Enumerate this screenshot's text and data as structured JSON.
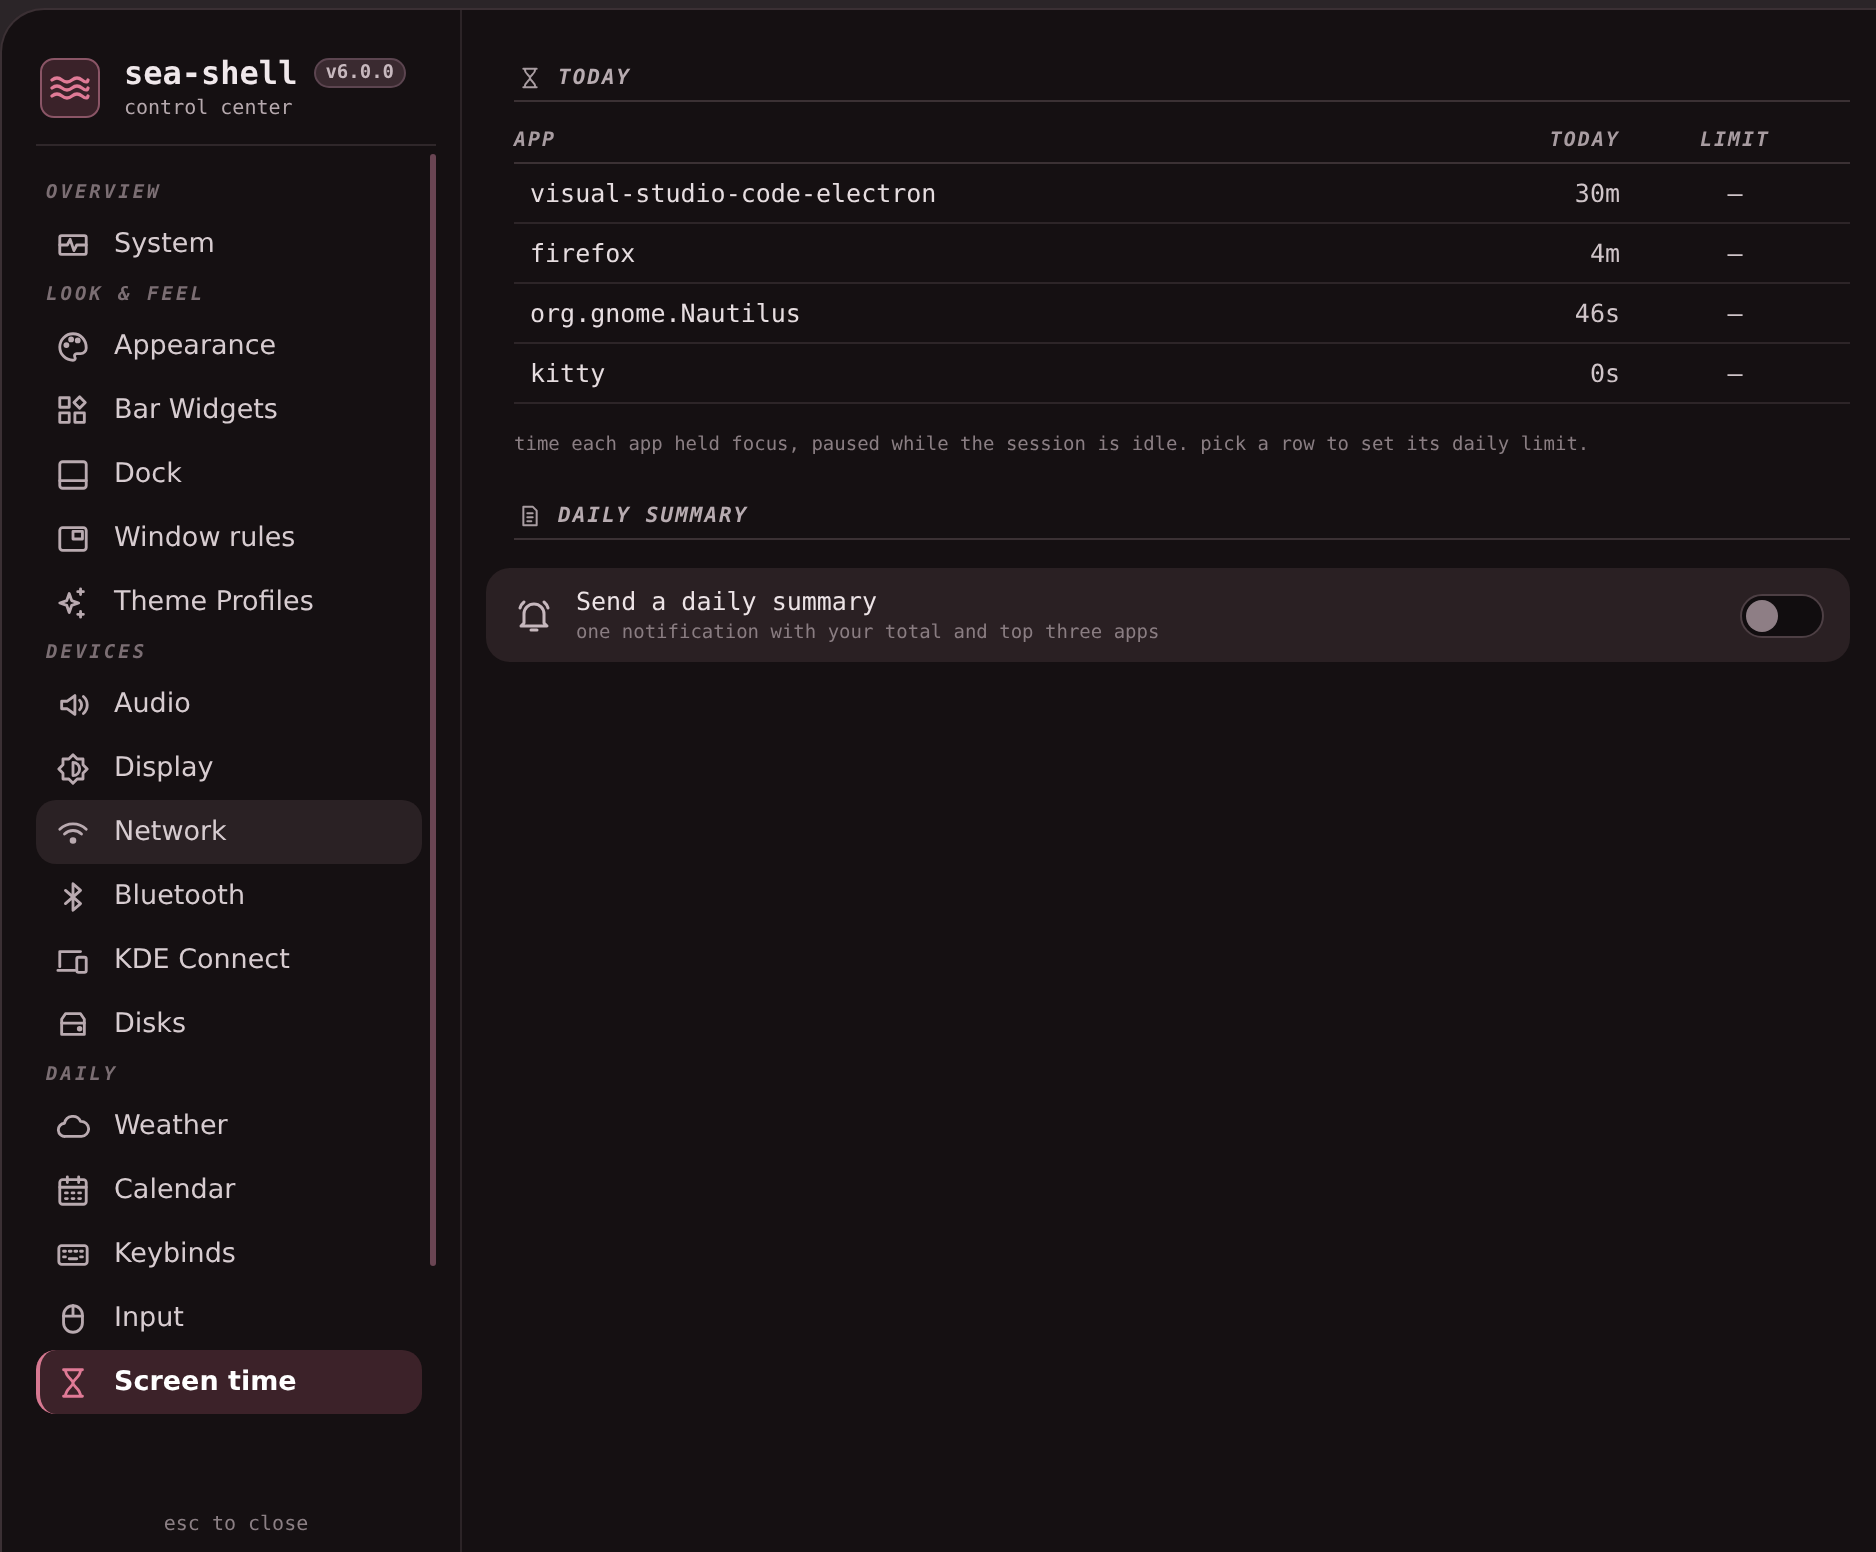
{
  "brand": {
    "name": "sea-shell",
    "version": "v6.0.0",
    "subtitle": "control center"
  },
  "sidebar": {
    "sections": [
      {
        "title": "OVERVIEW",
        "items": [
          {
            "label": "System",
            "selected": false,
            "hovered": false
          }
        ]
      },
      {
        "title": "LOOK & FEEL",
        "items": [
          {
            "label": "Appearance",
            "selected": false,
            "hovered": false
          },
          {
            "label": "Bar Widgets",
            "selected": false,
            "hovered": false
          },
          {
            "label": "Dock",
            "selected": false,
            "hovered": false
          },
          {
            "label": "Window rules",
            "selected": false,
            "hovered": false
          },
          {
            "label": "Theme Profiles",
            "selected": false,
            "hovered": false
          }
        ]
      },
      {
        "title": "DEVICES",
        "items": [
          {
            "label": "Audio",
            "selected": false,
            "hovered": false
          },
          {
            "label": "Display",
            "selected": false,
            "hovered": false
          },
          {
            "label": "Network",
            "selected": false,
            "hovered": true
          },
          {
            "label": "Bluetooth",
            "selected": false,
            "hovered": false
          },
          {
            "label": "KDE Connect",
            "selected": false,
            "hovered": false
          },
          {
            "label": "Disks",
            "selected": false,
            "hovered": false
          }
        ]
      },
      {
        "title": "DAILY",
        "items": [
          {
            "label": "Weather",
            "selected": false,
            "hovered": false
          },
          {
            "label": "Calendar",
            "selected": false,
            "hovered": false
          },
          {
            "label": "Keybinds",
            "selected": false,
            "hovered": false
          },
          {
            "label": "Input",
            "selected": false,
            "hovered": false
          },
          {
            "label": "Screen time",
            "selected": true,
            "hovered": false
          }
        ]
      }
    ],
    "footer": "esc to close"
  },
  "today": {
    "title": "TODAY",
    "columns": [
      "APP",
      "TODAY",
      "LIMIT"
    ],
    "rows": [
      {
        "app": "visual-studio-code-electron",
        "today": "30m",
        "limit": "–"
      },
      {
        "app": "firefox",
        "today": "4m",
        "limit": "–"
      },
      {
        "app": "org.gnome.Nautilus",
        "today": "46s",
        "limit": "–"
      },
      {
        "app": "kitty",
        "today": "0s",
        "limit": "–"
      }
    ],
    "note": "time each app held focus, paused while the session is idle. pick a row to set its daily limit."
  },
  "summary": {
    "title": "DAILY SUMMARY",
    "setting": {
      "label": "Send a daily summary",
      "description": "one notification with your total and top three apps",
      "on": false
    }
  }
}
